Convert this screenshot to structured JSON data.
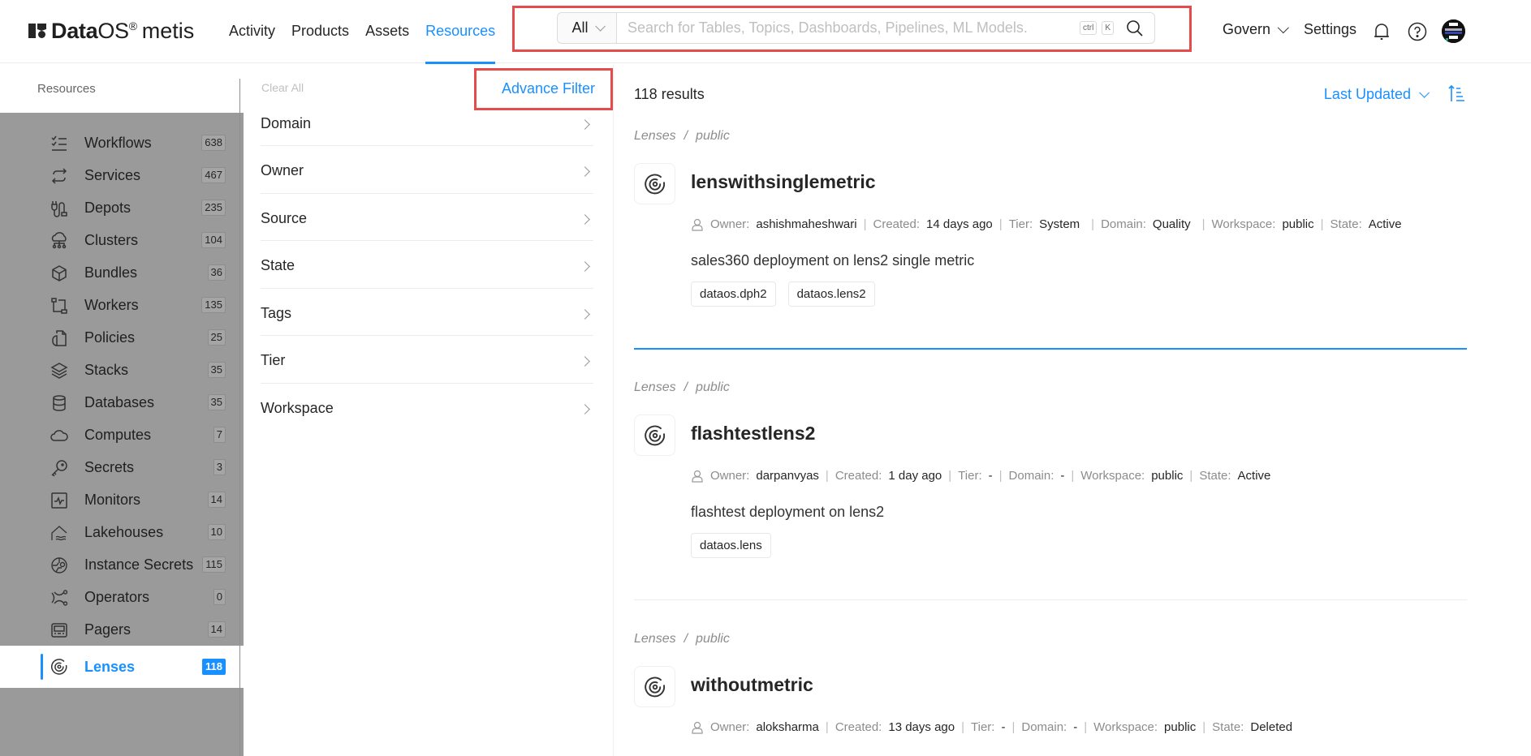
{
  "header": {
    "logo_brand_bold": "Data",
    "logo_brand_rest": "OS",
    "logo_reg": "®",
    "logo_product": "metis",
    "nav": [
      {
        "label": "Activity",
        "active": false
      },
      {
        "label": "Products",
        "active": false
      },
      {
        "label": "Assets",
        "active": false
      },
      {
        "label": "Resources",
        "active": true
      }
    ],
    "search": {
      "scope": "All",
      "placeholder": "Search for Tables, Topics, Dashboards, Pipelines, ML Models.",
      "value": "",
      "shortcut_key1": "ctrl",
      "shortcut_key2": "K",
      "icon": "search-icon"
    },
    "govern_label": "Govern",
    "settings_label": "Settings",
    "icons": [
      "bell-icon",
      "help-icon",
      "avatar"
    ]
  },
  "sidebar": {
    "title": "Resources",
    "items": [
      {
        "label": "Workflows",
        "count": "638",
        "icon": "workflow-icon",
        "active": false
      },
      {
        "label": "Services",
        "count": "467",
        "icon": "services-icon",
        "active": false
      },
      {
        "label": "Depots",
        "count": "235",
        "icon": "depot-icon",
        "active": false
      },
      {
        "label": "Clusters",
        "count": "104",
        "icon": "cluster-icon",
        "active": false
      },
      {
        "label": "Bundles",
        "count": "36",
        "icon": "bundle-icon",
        "active": false
      },
      {
        "label": "Workers",
        "count": "135",
        "icon": "worker-icon",
        "active": false
      },
      {
        "label": "Policies",
        "count": "25",
        "icon": "policy-icon",
        "active": false
      },
      {
        "label": "Stacks",
        "count": "35",
        "icon": "stack-icon",
        "active": false
      },
      {
        "label": "Databases",
        "count": "35",
        "icon": "database-icon",
        "active": false
      },
      {
        "label": "Computes",
        "count": "7",
        "icon": "cloud-icon",
        "active": false
      },
      {
        "label": "Secrets",
        "count": "3",
        "icon": "key-icon",
        "active": false
      },
      {
        "label": "Monitors",
        "count": "14",
        "icon": "monitor-icon",
        "active": false
      },
      {
        "label": "Lakehouses",
        "count": "10",
        "icon": "lakehouse-icon",
        "active": false
      },
      {
        "label": "Instance Secrets",
        "count": "115",
        "icon": "instance-secret-icon",
        "active": false
      },
      {
        "label": "Operators",
        "count": "0",
        "icon": "operator-icon",
        "active": false
      },
      {
        "label": "Pagers",
        "count": "14",
        "icon": "pager-icon",
        "active": false
      },
      {
        "label": "Lenses",
        "count": "118",
        "icon": "lens-icon",
        "active": true
      }
    ]
  },
  "filters": {
    "clear_all": "Clear All",
    "advance_filter": "Advance Filter",
    "items": [
      "Domain",
      "Owner",
      "Source",
      "State",
      "Tags",
      "Tier",
      "Workspace"
    ]
  },
  "results": {
    "count_label": "118 results",
    "sort_label": "Last Updated",
    "items": [
      {
        "crumb": [
          "Lenses",
          "public"
        ],
        "title": "lenswithsinglemetric",
        "meta": {
          "owner_k": "Owner:",
          "owner": "ashishmaheshwari",
          "created_k": "Created:",
          "created": "14 days ago",
          "tier_k": "Tier:",
          "tier": "System",
          "domain_k": "Domain:",
          "domain": "Quality",
          "workspace_k": "Workspace:",
          "workspace": "public",
          "state_k": "State:",
          "state": "Active"
        },
        "description": "sales360 deployment on lens2 single metric",
        "tags": [
          "dataos.dph2",
          "dataos.lens2"
        ]
      },
      {
        "crumb": [
          "Lenses",
          "public"
        ],
        "title": "flashtestlens2",
        "meta": {
          "owner_k": "Owner:",
          "owner": "darpanvyas",
          "created_k": "Created:",
          "created": "1 day ago",
          "tier_k": "Tier:",
          "tier": "-",
          "domain_k": "Domain:",
          "domain": "-",
          "workspace_k": "Workspace:",
          "workspace": "public",
          "state_k": "State:",
          "state": "Active"
        },
        "description": "flashtest deployment on lens2",
        "tags": [
          "dataos.lens"
        ]
      },
      {
        "crumb": [
          "Lenses",
          "public"
        ],
        "title": "withoutmetric",
        "meta": {
          "owner_k": "Owner:",
          "owner": "aloksharma",
          "created_k": "Created:",
          "created": "13 days ago",
          "tier_k": "Tier:",
          "tier": "-",
          "domain_k": "Domain:",
          "domain": "-",
          "workspace_k": "Workspace:",
          "workspace": "public",
          "state_k": "State:",
          "state": "Deleted"
        },
        "description": "",
        "tags": []
      }
    ]
  },
  "colors": {
    "accent": "#1890ff",
    "highlight_box": "#e54b4b",
    "sidebar_overlay": "#9a9a9a"
  }
}
